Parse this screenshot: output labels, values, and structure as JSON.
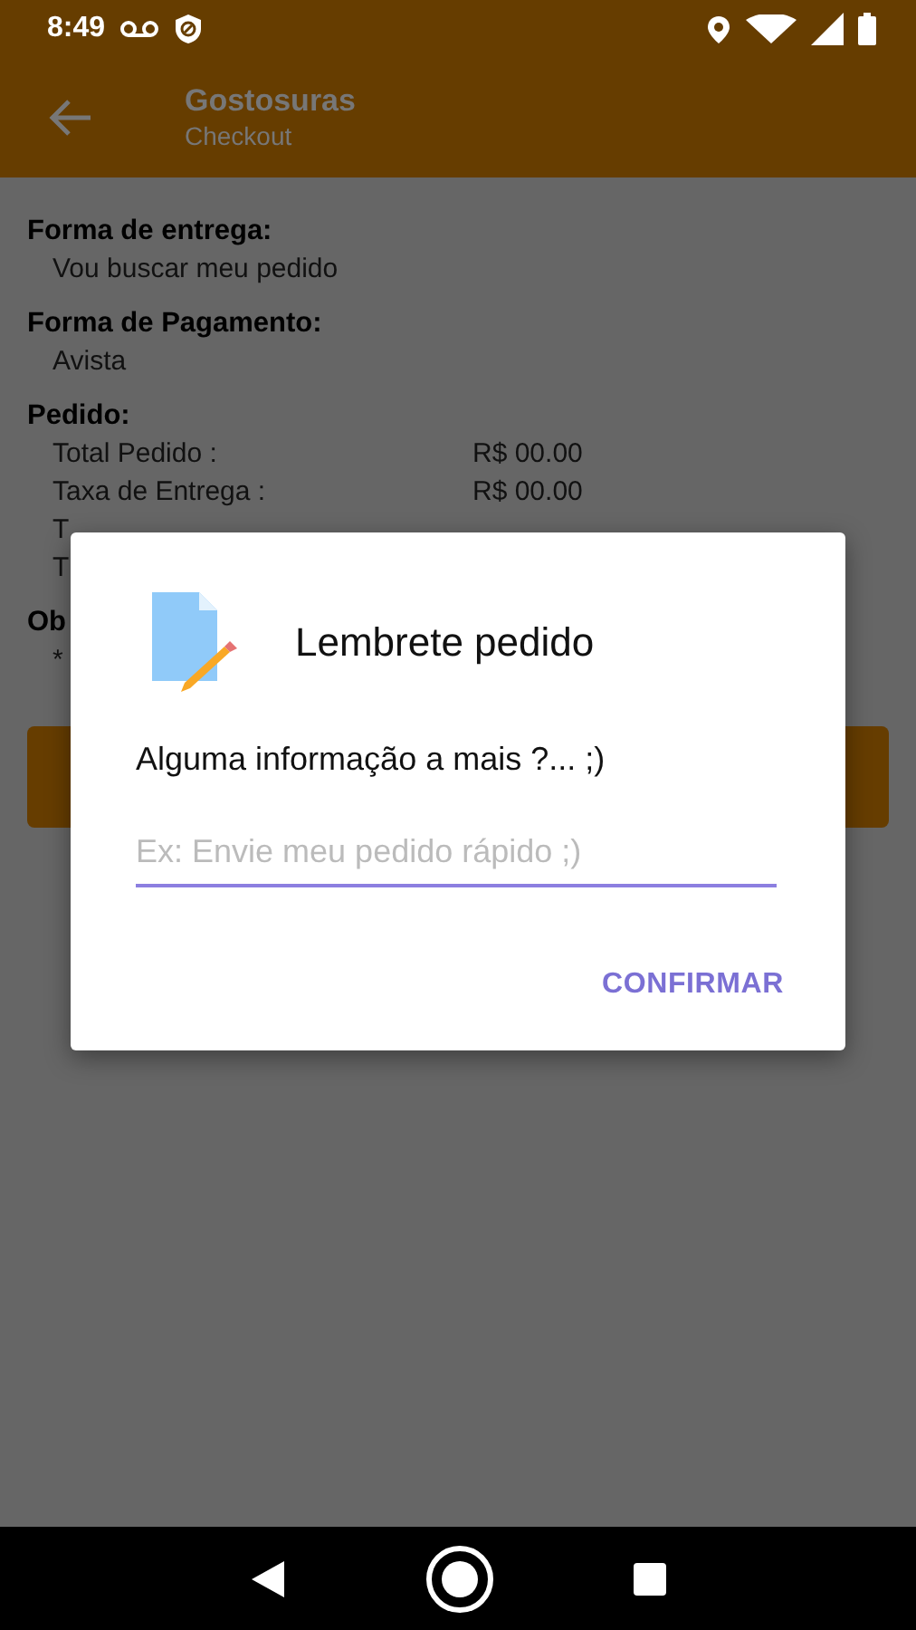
{
  "status_bar": {
    "time": "8:49"
  },
  "app_bar": {
    "title": "Gostosuras",
    "subtitle": "Checkout"
  },
  "sections": [
    {
      "heading": "Forma de entrega:",
      "lines": [
        {
          "text": "Vou buscar meu pedido"
        }
      ]
    },
    {
      "heading": "Forma de Pagamento:",
      "lines": [
        {
          "text": "Avista"
        }
      ]
    },
    {
      "heading": "Pedido:",
      "lines": [
        {
          "label": "Total Pedido :",
          "value": "R$ 00.00"
        },
        {
          "label": "Taxa de Entrega :",
          "value": "R$ 00.00"
        },
        {
          "label": "T"
        },
        {
          "label": "T"
        }
      ]
    },
    {
      "heading": "Ob",
      "lines": [
        {
          "text": "*"
        }
      ]
    }
  ],
  "dialog": {
    "title": "Lembrete pedido",
    "message": "Alguma informação a mais ?... ;)",
    "input": {
      "placeholder": "Ex: Envie meu pedido rápido ;)"
    },
    "buttons": [
      "CONFIRMAR"
    ]
  }
}
